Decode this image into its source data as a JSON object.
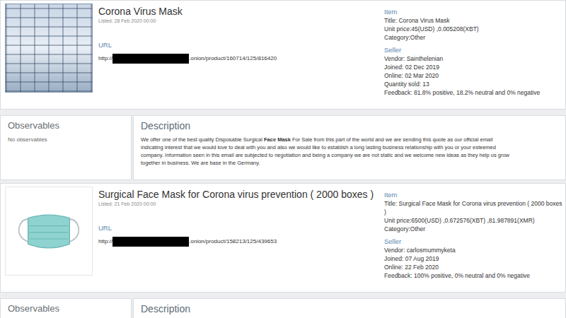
{
  "listings": [
    {
      "title": "Corona Virus Mask",
      "listed": "Listed: 28 Feb 2020 00:00",
      "url_label": "URL",
      "url": {
        "prefix": "http://",
        "suffix": ".onion/product/160714/125/816420"
      },
      "item": {
        "label": "Item",
        "lines": [
          "Title: Corona Virus Mask",
          "Unit price:45(USD) ,0.005208(XBT)",
          "Category:Other"
        ]
      },
      "seller": {
        "label": "Seller",
        "lines": [
          "Vendor: Sainthelenian",
          "Joined: 02 Dec 2019",
          "Online: 02 Mar 2020",
          "Quantity sold: 13",
          "Feedback: 81.8% positive, 18.2% neutral and 0% negative"
        ]
      },
      "observables": {
        "label": "Observables",
        "text": "No observables"
      },
      "description": {
        "label": "Description",
        "parts": [
          {
            "text": "We offer one of the best quality Disposable Surgical ",
            "highlight": false
          },
          {
            "text": "Face Mask",
            "highlight": true
          },
          {
            "text": " For Sale from this part of the world and we are sending this quote as our official email indicating interest that we would love to deal with you and also we would like to establish a long lasting business relationship with you or your esteemed company. Information seen in this email are subjected to negotiation and being a company we are not static and we welcome new ideas as they help us grow together in business. We are base in the Germany.",
            "highlight": false
          }
        ]
      }
    },
    {
      "title": "Surgical Face Mask for Corona virus prevention ( 2000 boxes )",
      "listed": "Listed: 21 Feb 2020 00:00",
      "url_label": "URL",
      "url": {
        "prefix": "http://",
        "suffix": ".onion/product/158213/125/439653"
      },
      "item": {
        "label": "Item",
        "lines": [
          "Title: Surgical Face Mask for Corona virus prevention ( 2000 boxes )",
          "Unit price:6500(USD) ,0.672576(XBT) ,81.987891(XMR)",
          "Category:Other"
        ]
      },
      "seller": {
        "label": "Seller",
        "lines": [
          "Vendor: carlosmummyketa",
          "Joined: 07 Aug 2019",
          "Online: 22 Feb 2020",
          "Feedback: 100% positive, 0% neutral and 0% negative"
        ]
      },
      "observables": {
        "label": "Observables"
      },
      "description": {
        "label": "Description",
        "parts": []
      }
    }
  ]
}
